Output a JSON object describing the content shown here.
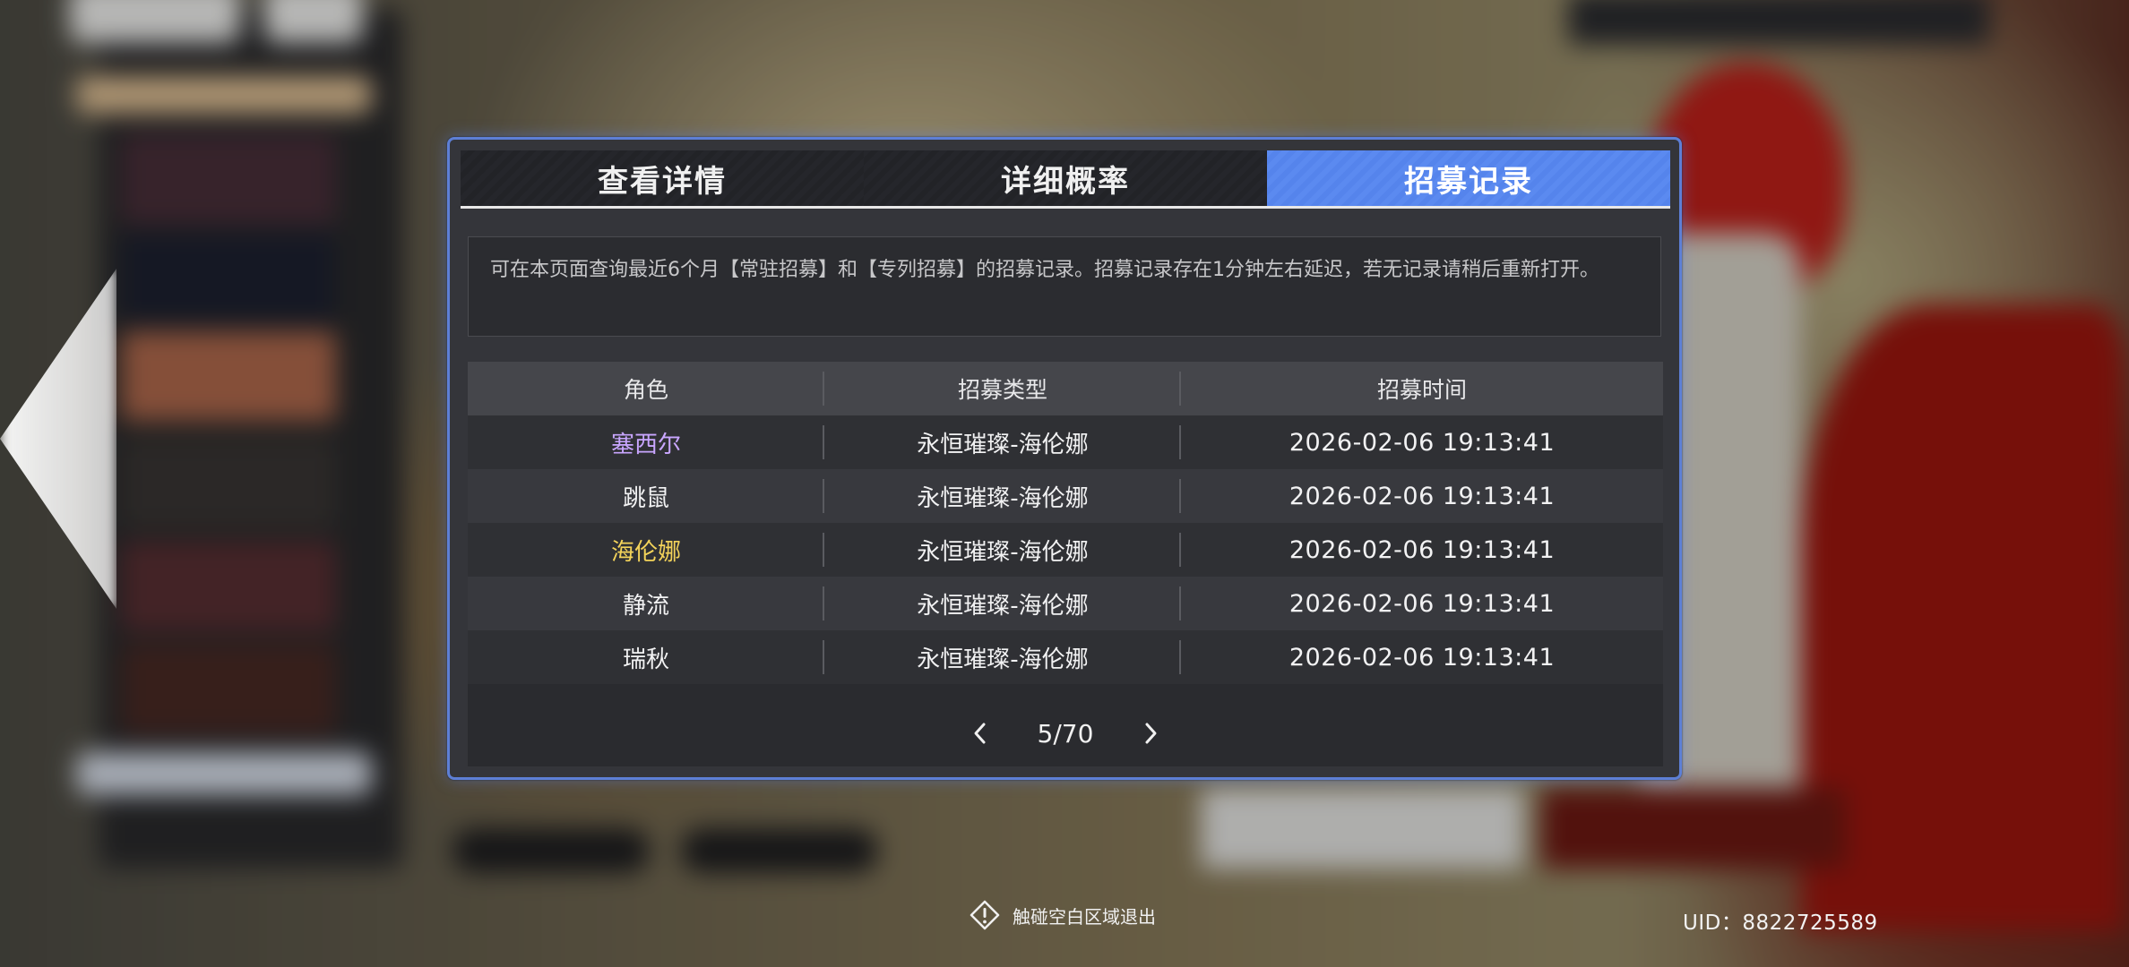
{
  "tabs": [
    {
      "label": "查看详情",
      "active": false
    },
    {
      "label": "详细概率",
      "active": false
    },
    {
      "label": "招募记录",
      "active": true
    }
  ],
  "notice": "可在本页面查询最近6个月【常驻招募】和【专列招募】的招募记录。招募记录存在1分钟左右延迟，若无记录请稍后重新打开。",
  "table": {
    "headers": [
      "角色",
      "招募类型",
      "招募时间"
    ],
    "rows": [
      {
        "character": "塞西尔",
        "type": "永恒璀璨-海伦娜",
        "time": "2026-02-06 19:13:41",
        "color": "#c9a6ff"
      },
      {
        "character": "跳鼠",
        "type": "永恒璀璨-海伦娜",
        "time": "2026-02-06 19:13:41",
        "color": "#f2f2f3"
      },
      {
        "character": "海伦娜",
        "type": "永恒璀璨-海伦娜",
        "time": "2026-02-06 19:13:41",
        "color": "#f3d35a"
      },
      {
        "character": "静流",
        "type": "永恒璀璨-海伦娜",
        "time": "2026-02-06 19:13:41",
        "color": "#f2f2f3"
      },
      {
        "character": "瑞秋",
        "type": "永恒璀璨-海伦娜",
        "time": "2026-02-06 19:13:41",
        "color": "#f2f2f3"
      }
    ]
  },
  "pager": {
    "prev_icon": "chevron-left-icon",
    "next_icon": "chevron-right-icon",
    "page_text": "5/70"
  },
  "footer": {
    "exit_hint": "触碰空白区域退出",
    "exit_icon": "warning-diamond-icon",
    "uid": "UID：8822725589"
  },
  "colors": {
    "accent": "#5b8af0",
    "dialog_border": "#5d7fd6",
    "rarity_purple": "#c9a6ff",
    "rarity_gold": "#f3d35a"
  }
}
